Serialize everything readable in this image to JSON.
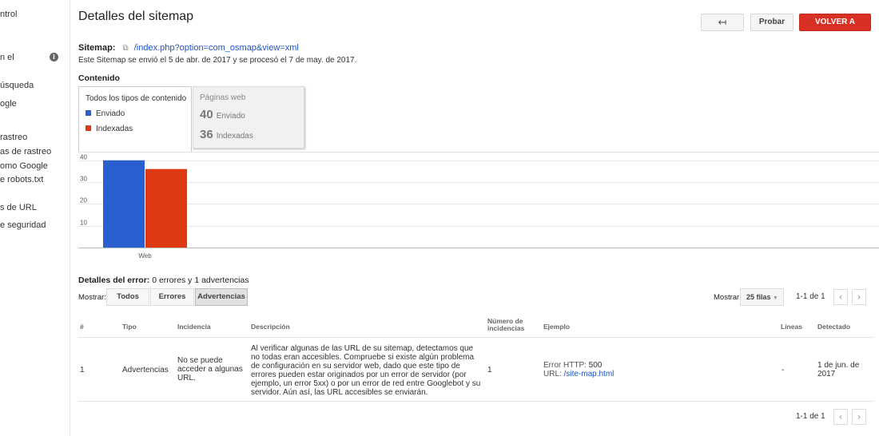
{
  "sidebar": {
    "items": [
      {
        "label": "ntrol"
      },
      {
        "label": "n el"
      },
      {
        "label": "úsqueda"
      },
      {
        "label": "ogle"
      },
      {
        "label": "rastreo"
      },
      {
        "label": "as de rastreo"
      },
      {
        "label": "omo Google"
      },
      {
        "label": "e robots.txt"
      },
      {
        "label": "s de URL"
      },
      {
        "label": "e seguridad"
      }
    ]
  },
  "header": {
    "title": "Detalles del sitemap",
    "back_label": "↤",
    "test_label": "Probar",
    "resubmit_label": "VOLVER A ENVIAR"
  },
  "sitemap": {
    "label": "Sitemap:",
    "url": "/index.php?option=com_osmap&view=xml",
    "info": "Este Sitemap se envió el 5 de abr. de 2017 y se procesó el 7 de may. de 2017."
  },
  "content": {
    "label": "Contenido",
    "tab_all": {
      "title": "Todos los tipos de contenido",
      "legend": [
        {
          "label": "Enviado",
          "color": "#2a5fcf"
        },
        {
          "label": "Indexadas",
          "color": "#dd3a13"
        }
      ]
    },
    "tab_web": {
      "title": "Páginas web",
      "submitted_count": "40",
      "submitted_label": "Enviado",
      "indexed_count": "36",
      "indexed_label": "Indexadas"
    }
  },
  "chart_data": {
    "type": "bar",
    "categories": [
      "Web"
    ],
    "series": [
      {
        "name": "Enviado",
        "values": [
          40
        ],
        "color": "#2a5fcf"
      },
      {
        "name": "Indexadas",
        "values": [
          36
        ],
        "color": "#dd3a13"
      }
    ],
    "yticks": [
      10,
      20,
      30,
      40
    ],
    "ylim": [
      0,
      41
    ]
  },
  "errors": {
    "title_bold": "Detalles del error:",
    "title_rest": " 0 errores y 1 advertencias",
    "show_label": "Mostrar:",
    "filters": [
      "Todos",
      "Errores",
      "Advertencias"
    ],
    "show_right_label": "Mostrar",
    "rows_select": "25 filas",
    "pager_text": "1-1 de 1",
    "prev": "‹",
    "next": "›",
    "columns": [
      "#",
      "Tipo",
      "Incidencia",
      "Descripción",
      "Número de incidencias",
      "Ejemplo",
      "Líneas",
      "Detectado"
    ],
    "rows": [
      {
        "num": "1",
        "type": "Advertencias",
        "issue": "No se puede acceder a algunas URL.",
        "description": "Al verificar algunas de las URL de su sitemap, detectamos que no todas eran accesibles. Compruebe si existe algún problema de configuración en su servidor web, dado que este tipo de errores pueden estar originados por un error de servidor (por ejemplo, un error 5xx) o por un error de red entre Googlebot y su servidor. Aún así, las URL accesibles se enviarán.",
        "count": "1",
        "example_error_label": "Error HTTP:",
        "example_error_code": "500",
        "example_url_label": "URL:",
        "example_url": "/site-map.html",
        "lines": "-",
        "detected": "1 de jun. de 2017"
      }
    ]
  }
}
